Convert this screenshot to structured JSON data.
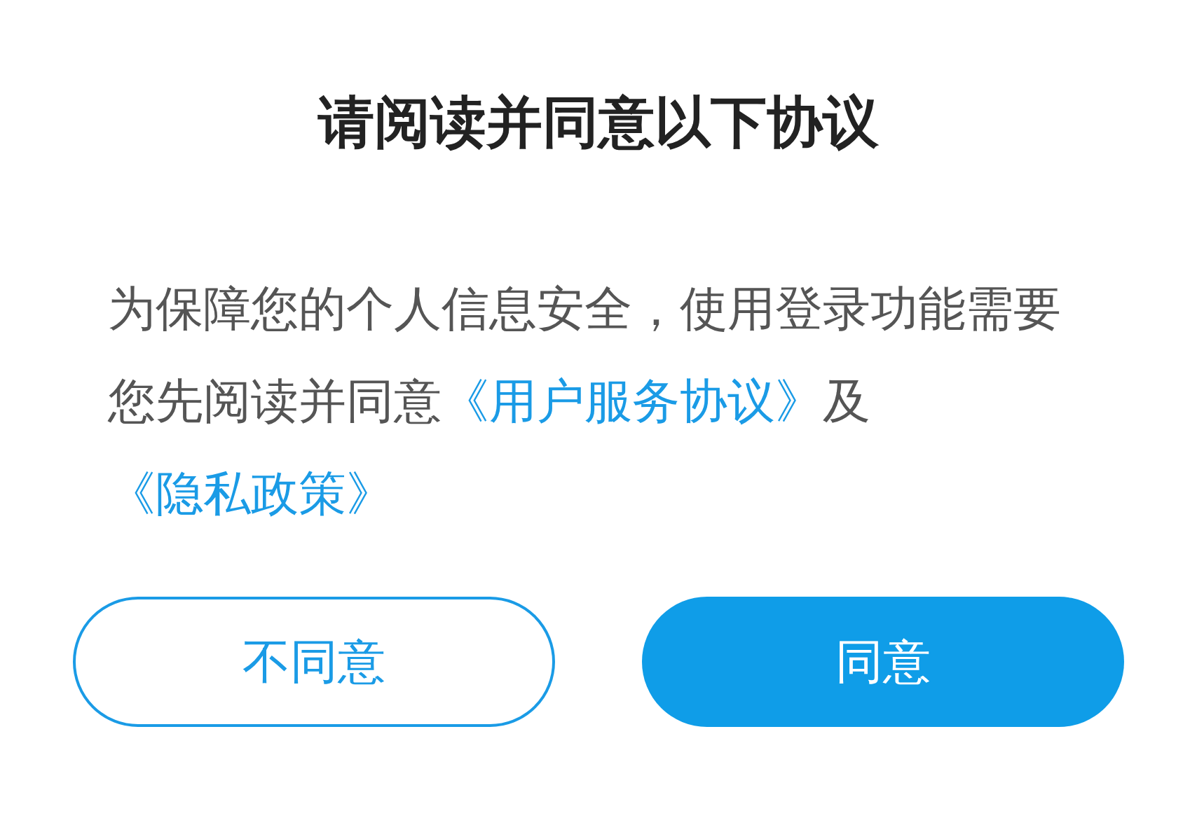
{
  "title": "请阅读并同意以下协议",
  "message": [
    {
      "kind": "text",
      "text": "为保障您的个人信息安全，使用登录功能需要您先阅读并同意"
    },
    {
      "kind": "link",
      "text": "《用户服务协议》"
    },
    {
      "kind": "text",
      "text": "及"
    },
    {
      "kind": "link",
      "text": "《隐私政策》"
    }
  ],
  "buttons": [
    {
      "label": "不同意",
      "kind": "outline"
    },
    {
      "label": "同意",
      "kind": "filled"
    }
  ]
}
